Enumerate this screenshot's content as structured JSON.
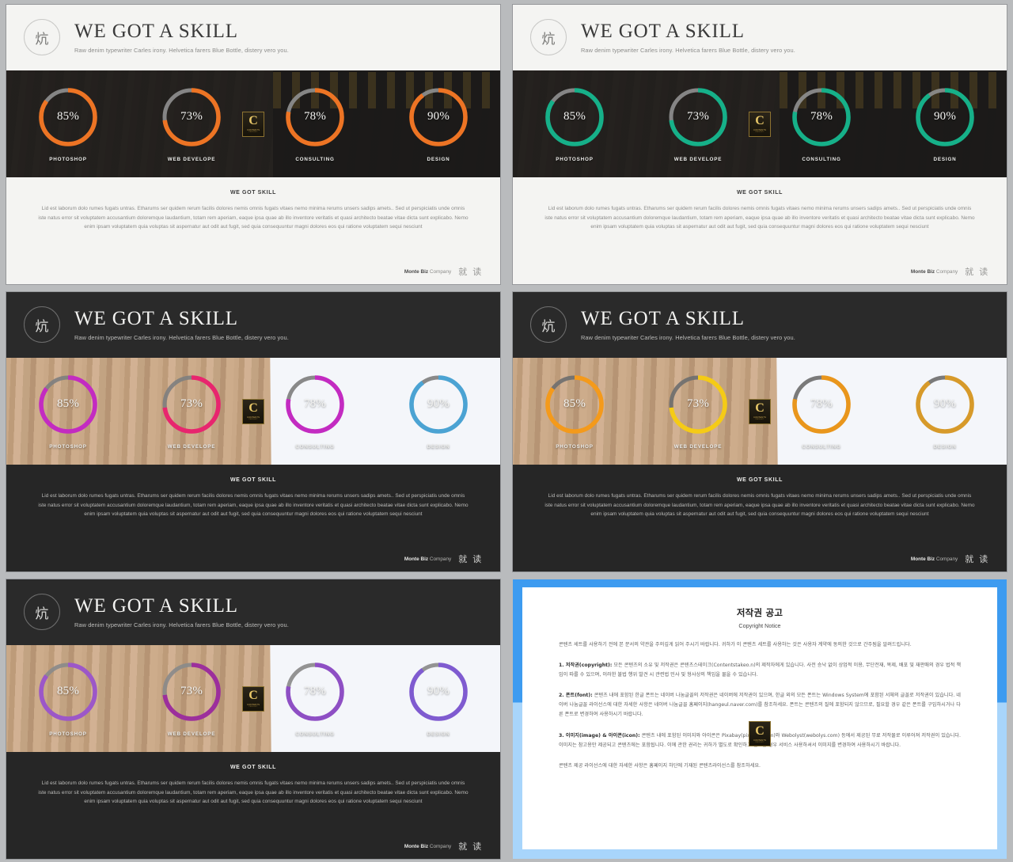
{
  "header": {
    "logo_glyph": "炕",
    "title": "WE GOT A SKILL",
    "subtitle": "Raw denim typewriter Carles irony. Helvetica farers Blue Bottle, distery vero you."
  },
  "body": {
    "title": "WE GOT SKILL",
    "paragraph": "Lid est laborum dolo rumes fugats untras. Etharums ser quidem rerum facilis dolores nemis omnis fugats vitaes nemo minima rerums unsers sadips amets.. Sed ut perspiciatis unde omnis iste natus error sit voluptatem accusantium doloremque laudantium, totam rem aperiam, eaque ipsa quae ab illo inventore veritatis et quasi architecto beatae vitae dicta sunt explicabo. Nemo enim ipsam voluptatem quia voluptas sit aspernatur aut odit aut fugit, sed quia consequuntur magni dolores eos qui ratione voluptatem sequi nesciunt"
  },
  "footer": {
    "brand": "Monte Biz",
    "company": "Company",
    "cjk": "就 读"
  },
  "badge": {
    "letter": "C",
    "line1": "CONTENTS",
    "line2": "PRODUCT"
  },
  "skills": [
    {
      "label": "PHOTOSHOP",
      "value": 85,
      "value_text": "85%"
    },
    {
      "label": "WEB DEVELOPE",
      "value": 73,
      "value_text": "73%"
    },
    {
      "label": "CONSULTING",
      "value": 78,
      "value_text": "78%"
    },
    {
      "label": "DESIGN",
      "value": 90,
      "value_text": "90%"
    }
  ],
  "slides": [
    {
      "id": "slide-1",
      "theme": "light",
      "background": "desk",
      "ring_colors": [
        "#ED7424",
        "#ED7424",
        "#ED7424",
        "#ED7424"
      ],
      "track_color": "#8e8e8e"
    },
    {
      "id": "slide-2",
      "theme": "light",
      "background": "desk",
      "ring_colors": [
        "#16B089",
        "#16B089",
        "#16B089",
        "#16B089"
      ],
      "track_color": "#8e8e8e"
    },
    {
      "id": "slide-3",
      "theme": "dark",
      "background": "wood",
      "ring_colors": [
        "#C32BC1",
        "#E8256E",
        "#C32BC1",
        "#4BA3D3"
      ],
      "track_color": "#7f7f7f"
    },
    {
      "id": "slide-4",
      "theme": "dark",
      "background": "wood",
      "ring_colors": [
        "#F49A1B",
        "#F5CB16",
        "#E9961C",
        "#D79A2A"
      ],
      "track_color": "#6f6f6f"
    },
    {
      "id": "slide-5",
      "theme": "dark",
      "background": "wood",
      "ring_colors": [
        "#9C57C8",
        "#9C2F9C",
        "#8E4FC4",
        "#7F5BD0"
      ],
      "track_color": "#8a8a8a"
    }
  ],
  "copyright": {
    "title": "저작권 공고",
    "subtitle": "Copyright Notice",
    "intro": "콘텐츠 세트를 사용하기 전에 본 문서의 약관을 주의깊게 읽어 주시기 바랍니다. 귀하가 이 콘텐츠 세트를 사용하는 것은 사용자 계약에 동의한 것으로 간주됨을 알려드립니다.",
    "sections": [
      {
        "heading": "1. 저작권(copyright):",
        "text": " 모든 콘텐츠의 소유 및 저작권은 콘텐츠스테이크(Contentstakeo.n)의 제작자에게 있습니다. 사전 승낙 없이 상업적 이용, 무단전재, 복제, 배포 및 재판매의 경우 법적 책임이 따를 수 있으며, 이러한 불법 행위 발견 시 관련법 민사 및 형사상의 책임을 물을 수 있습니다."
      },
      {
        "heading": "2. 폰트(font):",
        "text": " 콘텐츠 내에 포함된 한글 폰트는 네이버 나눔글꼴의 저작권은 네이버에 저작권이 있으며, 한글 외의 모든 폰트는 Windows System에 포함된 서체의 글꼴로 저작권이 있습니다. 네이버 나눔글꼴 라이선스에 대한 자세한 사항은 네이버 나눔글꼴 홈페이지(hangeul.naver.com)를 참조하세요. 폰트는 콘텐츠의 질에 포함되지 않으므로, 필요할 경우 같은 폰트를 구입하시거나 다른 폰트로 변경하여 사용하시기 바랍니다."
      },
      {
        "heading": "3. 이미지(image) & 아이콘(icon):",
        "text": " 콘텐츠 내에 포함된 이미지와 아이콘은 Pixabay(pixabay.com)와 Webolyst(webolys.com) 등에서 제공된 무료 저작물로 이루어져 저작권이 있습니다. 이미지는 참고용만 제공되고 콘텐츠에는 포함됩니다. 이에 관한 권리는 귀하가 별도로 확인하고 필요할 경우 서비스 사용하셔서 이미지를 변경하여 사용하시기 바랍니다."
      }
    ],
    "outro": "콘텐츠 제공 라이선스에 대한 자세한 사항은 홈페이지 하단에 기재된 콘텐츠라이선스를 참조하세요."
  }
}
